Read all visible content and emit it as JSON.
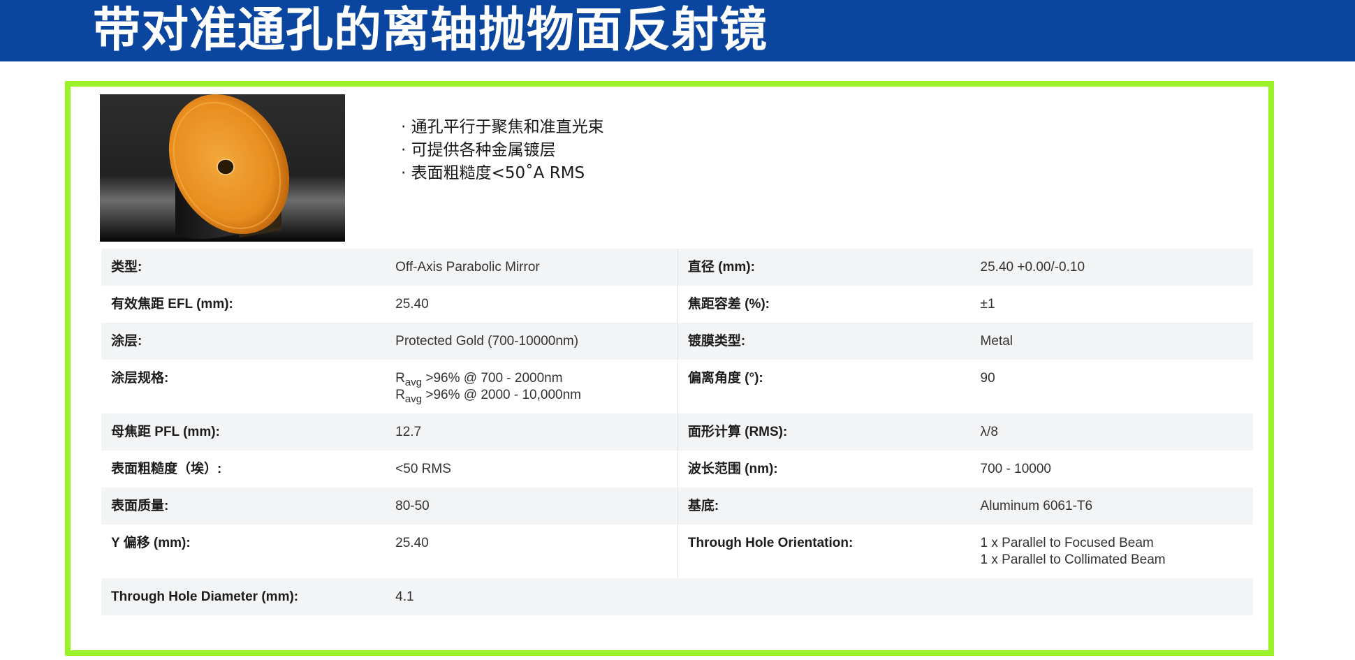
{
  "title": "带对准通孔的离轴抛物面反射镜",
  "features": [
    "通孔平行于聚焦和准直光束",
    "可提供各种金属镀层",
    "表面粗糙度<50˚A RMS"
  ],
  "specs": {
    "type_label": "类型:",
    "type_value": "Off-Axis Parabolic Mirror",
    "diameter_label": "直径 (mm):",
    "diameter_value": "25.40 +0.00/-0.10",
    "efl_label": "有效焦距 EFL (mm):",
    "efl_value": "25.40",
    "fl_tol_label": "焦距容差 (%):",
    "fl_tol_value": "±1",
    "coating_label": "涂层:",
    "coating_value": "Protected Gold (700-10000nm)",
    "coating_type_label": "镀膜类型:",
    "coating_type_value": "Metal",
    "coating_spec_label": "涂层规格:",
    "coating_spec_r": "R",
    "coating_spec_sub": "avg",
    "coating_spec_1": " >96% @ 700 - 2000nm",
    "coating_spec_2": " >96% @ 2000 - 10,000nm",
    "off_angle_label": "偏离角度 (°):",
    "off_angle_value": "90",
    "pfl_label": "母焦距 PFL (mm):",
    "pfl_value": "12.7",
    "surface_calc_label": "面形计算 (RMS):",
    "surface_calc_value": "λ/8",
    "roughness_label": "表面粗糙度（埃）:",
    "roughness_value": "<50 RMS",
    "wavelength_label": "波长范围 (nm):",
    "wavelength_value": "700 - 10000",
    "quality_label": "表面质量:",
    "quality_value": "80-50",
    "substrate_label": "基底:",
    "substrate_value": "Aluminum 6061-T6",
    "y_offset_label": "Y 偏移 (mm):",
    "y_offset_value": "25.40",
    "hole_orient_label": "Through Hole Orientation:",
    "hole_orient_1": "1 x Parallel to Focused Beam",
    "hole_orient_2": "1 x Parallel to Collimated Beam",
    "hole_dia_label": "Through Hole Diameter (mm):",
    "hole_dia_value": "4.1"
  },
  "colors": {
    "header": "#0a45a0",
    "frame": "#99f22a",
    "row_stripe": "#f3f4f5"
  }
}
